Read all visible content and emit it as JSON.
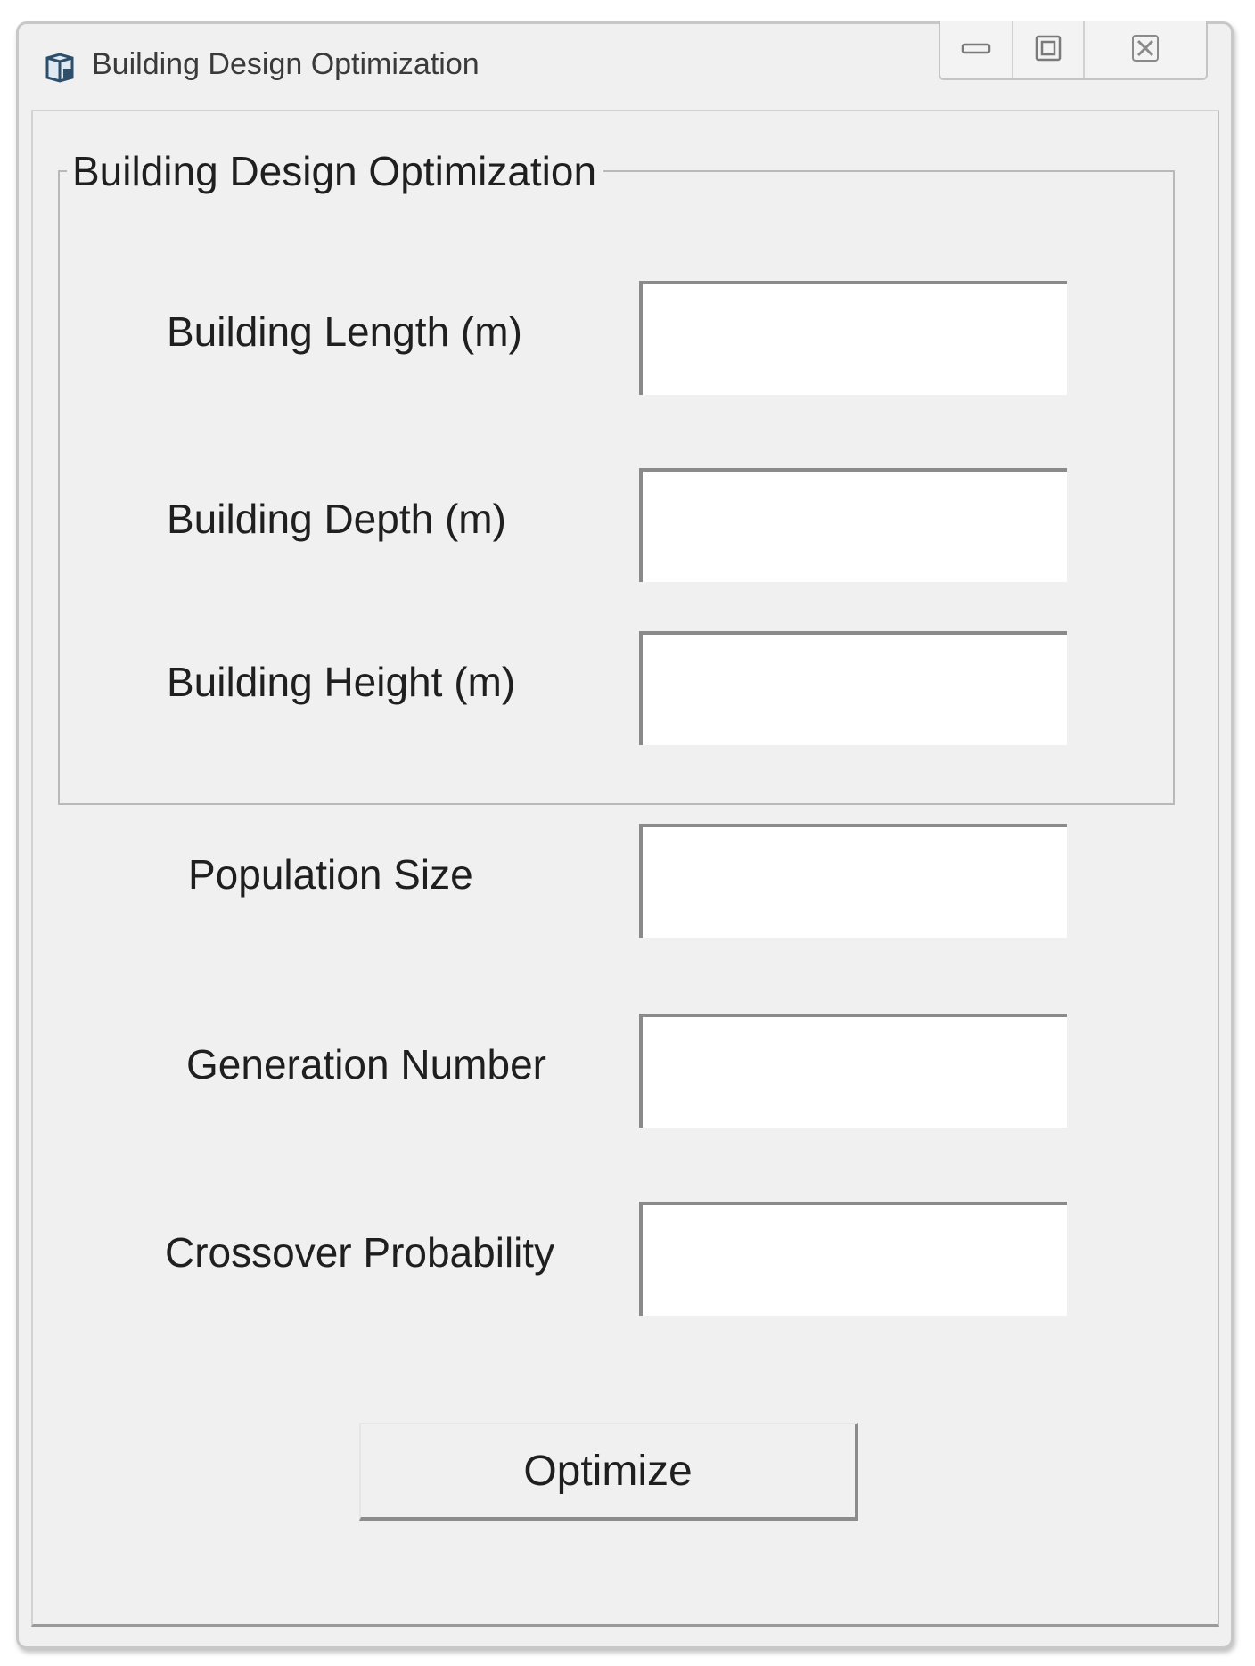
{
  "window": {
    "title": "Building Design Optimization",
    "app_icon": "form-icon",
    "controls": {
      "minimize_icon": "minimize-icon",
      "maximize_icon": "maximize-icon",
      "close_icon": "close-icon"
    }
  },
  "group": {
    "title": "Building Design Optimization",
    "fields": [
      {
        "label": "Building Length (m)",
        "value": ""
      },
      {
        "label": "Building Depth (m)",
        "value": ""
      },
      {
        "label": "Building Height (m)",
        "value": ""
      }
    ]
  },
  "params": [
    {
      "label": "Population Size",
      "value": ""
    },
    {
      "label": "Generation Number",
      "value": ""
    },
    {
      "label": "Crossover Probability",
      "value": ""
    }
  ],
  "optimize_button": {
    "label": "Optimize"
  },
  "colors": {
    "window_bg": "#f0f0f0",
    "input_bg": "#ffffff",
    "text": "#1f1f1f"
  }
}
